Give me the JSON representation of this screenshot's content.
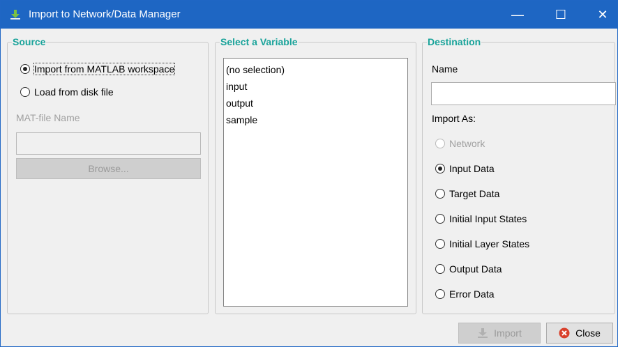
{
  "window": {
    "title": "Import to Network/Data Manager",
    "minimize_glyph": "—",
    "maximize_glyph": "☐",
    "close_glyph": "✕",
    "titlebar_color": "#1e66c3",
    "legend_color": "#19a39a"
  },
  "source": {
    "legend": "Source",
    "options": [
      {
        "label": "Import from MATLAB workspace",
        "checked": true
      },
      {
        "label": "Load from disk file",
        "checked": false
      }
    ],
    "matfile_label": "MAT-file Name",
    "matfile_value": "",
    "browse_label": "Browse..."
  },
  "variable": {
    "legend": "Select a Variable",
    "items": [
      "(no selection)",
      "input",
      "output",
      "sample"
    ]
  },
  "destination": {
    "legend": "Destination",
    "name_label": "Name",
    "name_value": "",
    "import_as_label": "Import As:",
    "options": [
      {
        "label": "Network",
        "checked": false,
        "disabled": true
      },
      {
        "label": "Input Data",
        "checked": true,
        "disabled": false
      },
      {
        "label": "Target Data",
        "checked": false,
        "disabled": false
      },
      {
        "label": "Initial Input States",
        "checked": false,
        "disabled": false
      },
      {
        "label": "Initial Layer States",
        "checked": false,
        "disabled": false
      },
      {
        "label": "Output Data",
        "checked": false,
        "disabled": false
      },
      {
        "label": "Error Data",
        "checked": false,
        "disabled": false
      }
    ]
  },
  "footer": {
    "import_label": "Import",
    "close_label": "Close"
  }
}
